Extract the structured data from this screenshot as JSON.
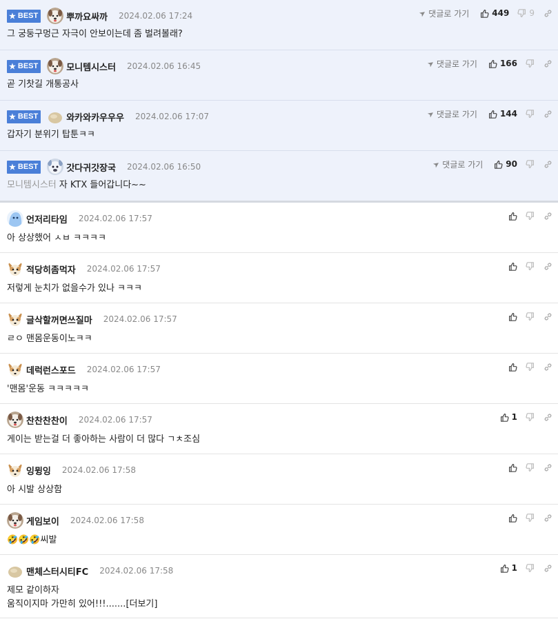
{
  "labels": {
    "best": "BEST",
    "reply": "댓글로 가기",
    "more": "[더보기]"
  },
  "colors": {
    "best_bg": "#eef2fb",
    "badge": "#4a7fd8"
  },
  "comments": [
    {
      "best": true,
      "avatar": "dog-white-icon",
      "nick": "뿌까요싸까",
      "date": "2024.02.06 17:24",
      "reply": true,
      "up": "449",
      "down": "9",
      "text": "그 궁둥구멍근 자극이 안보이는데 좀 벌려볼래?"
    },
    {
      "best": true,
      "avatar": "dog-white-icon",
      "nick": "모니템시스터",
      "date": "2024.02.06 16:45",
      "reply": true,
      "up": "166",
      "down": "",
      "text": "곧 기찻길 개통공사"
    },
    {
      "best": true,
      "avatar": "potato-icon",
      "nick": "와카와카우우우",
      "date": "2024.02.06 17:07",
      "reply": true,
      "up": "144",
      "down": "",
      "text": "갑자기 분위기 탑툰ㅋㅋ"
    },
    {
      "best": true,
      "avatar": "ghost-dog-icon",
      "nick": "갓다귀갓장국",
      "date": "2024.02.06 16:50",
      "reply": true,
      "up": "90",
      "down": "",
      "mention": "모니템시스터",
      "text": "자 KTX 들어갑니다~~"
    },
    {
      "best": false,
      "avatar": "blue-blob-icon",
      "nick": "언저리타임",
      "date": "2024.02.06 17:57",
      "reply": false,
      "up": "",
      "down": "",
      "text": "아 상상했어 ㅅㅂ ㅋㅋㅋㅋ"
    },
    {
      "best": false,
      "avatar": "chihuahua-icon",
      "nick": "적당히좀먹자",
      "date": "2024.02.06 17:57",
      "reply": false,
      "up": "",
      "down": "",
      "text": "저렇게 눈치가 없을수가 있나 ㅋㅋㅋ"
    },
    {
      "best": false,
      "avatar": "chihuahua-icon",
      "nick": "글삭할꺼면쓰질마",
      "date": "2024.02.06 17:57",
      "reply": false,
      "up": "",
      "down": "",
      "text": "ㄹㅇ 맨몸운동이노ㅋㅋ"
    },
    {
      "best": false,
      "avatar": "chihuahua-icon",
      "nick": "데럭런스포드",
      "date": "2024.02.06 17:57",
      "reply": false,
      "up": "",
      "down": "",
      "text": "'맨몸'운동 ㅋㅋㅋㅋㅋ"
    },
    {
      "best": false,
      "avatar": "dog-white-icon",
      "nick": "찬찬찬찬이",
      "date": "2024.02.06 17:57",
      "reply": false,
      "up": "1",
      "down": "",
      "text": "게이는 받는걸 더 좋아하는 사람이 더 많다 ㄱㅊ조심"
    },
    {
      "best": false,
      "avatar": "chihuahua-icon",
      "nick": "잉뮝잉",
      "date": "2024.02.06 17:58",
      "reply": false,
      "up": "",
      "down": "",
      "text": "아 시발 상상함"
    },
    {
      "best": false,
      "avatar": "dog-white-icon",
      "nick": "게임보이",
      "date": "2024.02.06 17:58",
      "reply": false,
      "up": "",
      "down": "",
      "text": "🤣🤣🤣씨발"
    },
    {
      "best": false,
      "avatar": "potato-icon",
      "nick": "맨체스터시티FC",
      "date": "2024.02.06 17:58",
      "reply": false,
      "up": "1",
      "down": "",
      "text": "제모 같이하자",
      "text2": "움직이지마 가만히 있어!!!.......",
      "more": true
    }
  ]
}
